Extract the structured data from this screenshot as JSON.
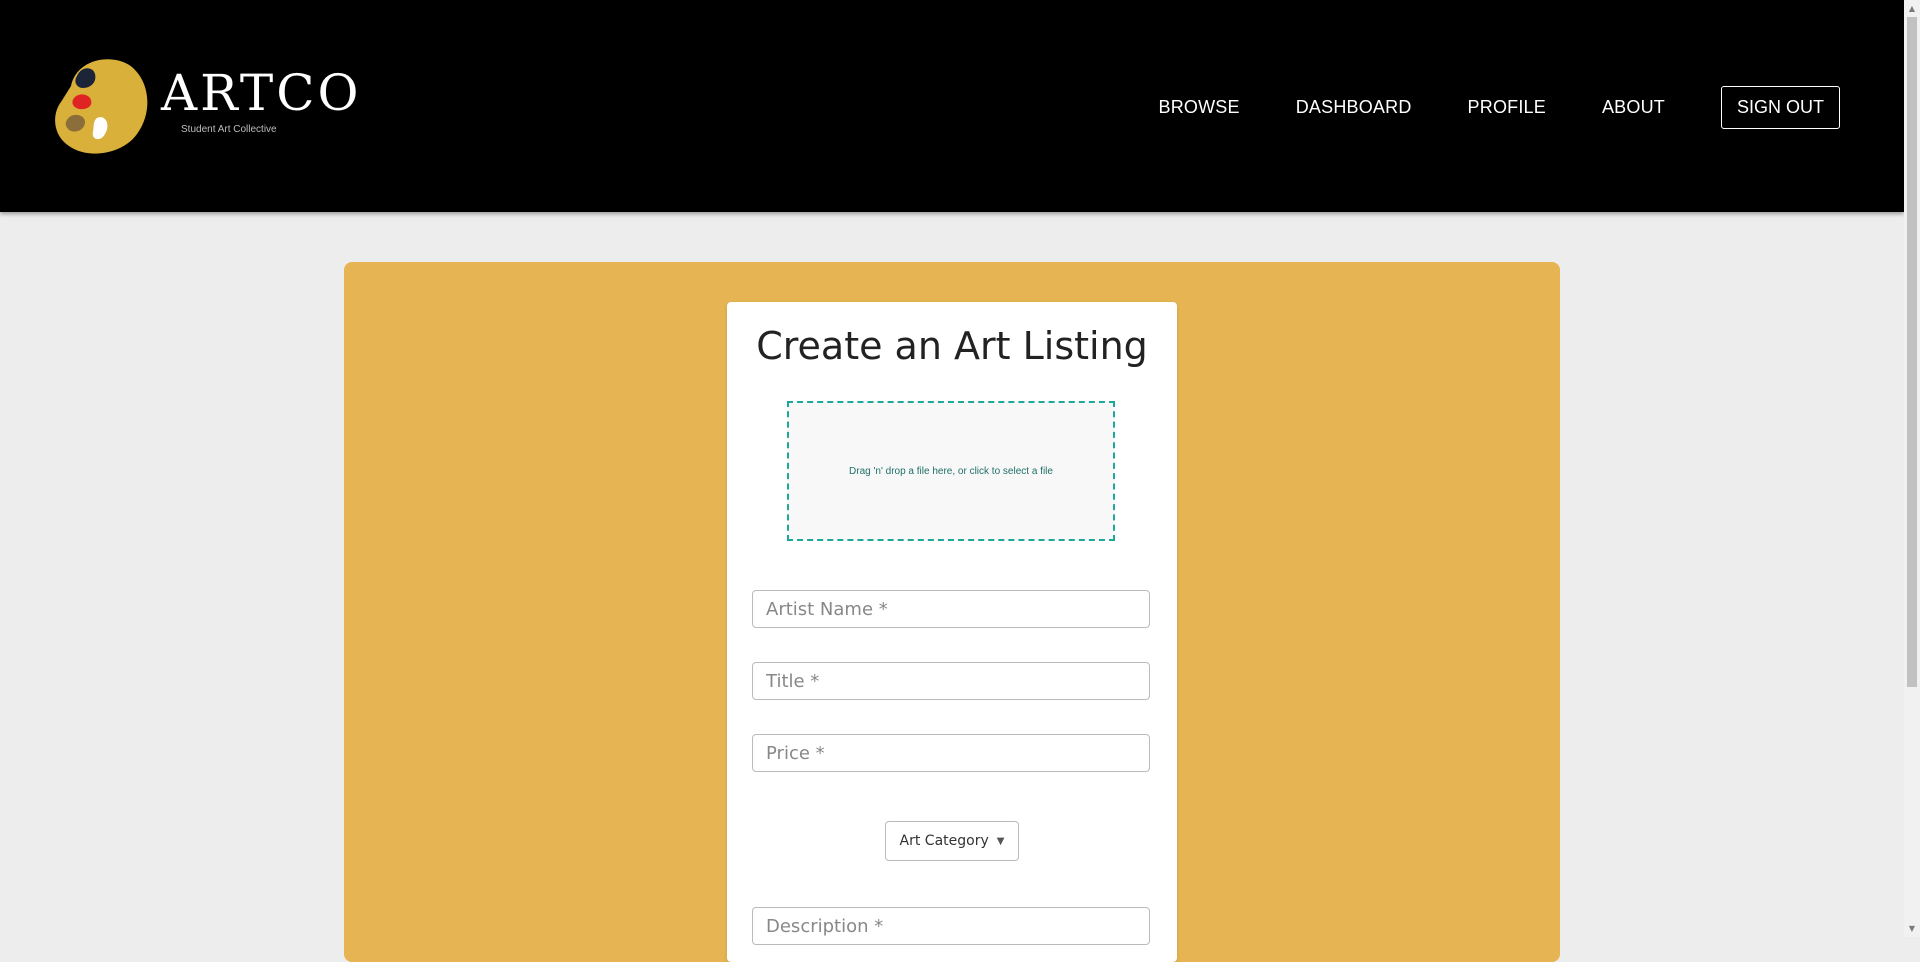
{
  "brand": {
    "name": "ARTCO",
    "tagline": "Student Art Collective",
    "palette_colors": [
      "#d9b13a",
      "#1c2438",
      "#e02424",
      "#8c6e3a",
      "#ffffff"
    ]
  },
  "nav": {
    "links": [
      {
        "label": "BROWSE"
      },
      {
        "label": "DASHBOARD"
      },
      {
        "label": "PROFILE"
      },
      {
        "label": "ABOUT"
      }
    ],
    "signout_label": "SIGN OUT"
  },
  "form": {
    "title": "Create an Art Listing",
    "dropzone_text": "Drag 'n' drop a file here, or click to select a file",
    "artist_placeholder": "Artist Name *",
    "title_placeholder": "Title *",
    "price_placeholder": "Price *",
    "category_label": "Art Category",
    "description_placeholder": "Description *"
  },
  "colors": {
    "navbar": "#000000",
    "panel": "#e6b452",
    "dropzone_border": "#1ea89a",
    "page_bg": "#ededed"
  }
}
